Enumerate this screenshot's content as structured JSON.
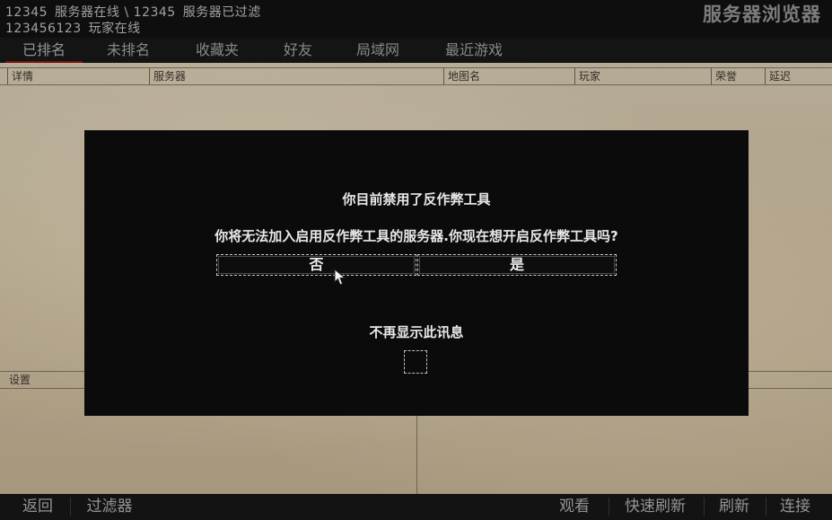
{
  "status": {
    "line1_servers_online_count": "12345",
    "line1_servers_online_label": "服务器在线 \\",
    "line1_servers_filtered_count": "12345",
    "line1_servers_filtered_label": "服务器已过滤",
    "line2_players_count": "123456123",
    "line2_players_label": "玩家在线"
  },
  "app_title": "服务器浏览器",
  "tabs": [
    {
      "label": "已排名",
      "active": true
    },
    {
      "label": "未排名",
      "active": false
    },
    {
      "label": "收藏夹",
      "active": false
    },
    {
      "label": "好友",
      "active": false
    },
    {
      "label": "局域网",
      "active": false
    },
    {
      "label": "最近游戏",
      "active": false
    }
  ],
  "columns": [
    "详情",
    "服务器",
    "地图名",
    "玩家",
    "荣誉",
    "延迟"
  ],
  "lower_panel": {
    "left_header": "设置"
  },
  "bottom_bar": {
    "back": "返回",
    "filter": "过滤器",
    "spectate": "观看",
    "quick_refresh": "快速刷新",
    "refresh": "刷新",
    "connect": "连接"
  },
  "dialog": {
    "title": "你目前禁用了反作弊工具",
    "message": "你将无法加入启用反作弊工具的服务器.你现在想开启反作弊工具吗?",
    "no_label": "否",
    "yes_label": "是",
    "dont_show_label": "不再显示此讯息",
    "dont_show_checked": false
  },
  "colors": {
    "accent_tab_underline": "#8a1515",
    "dialog_bg": "#0b0b0b",
    "parchment": "#c8b99c"
  }
}
